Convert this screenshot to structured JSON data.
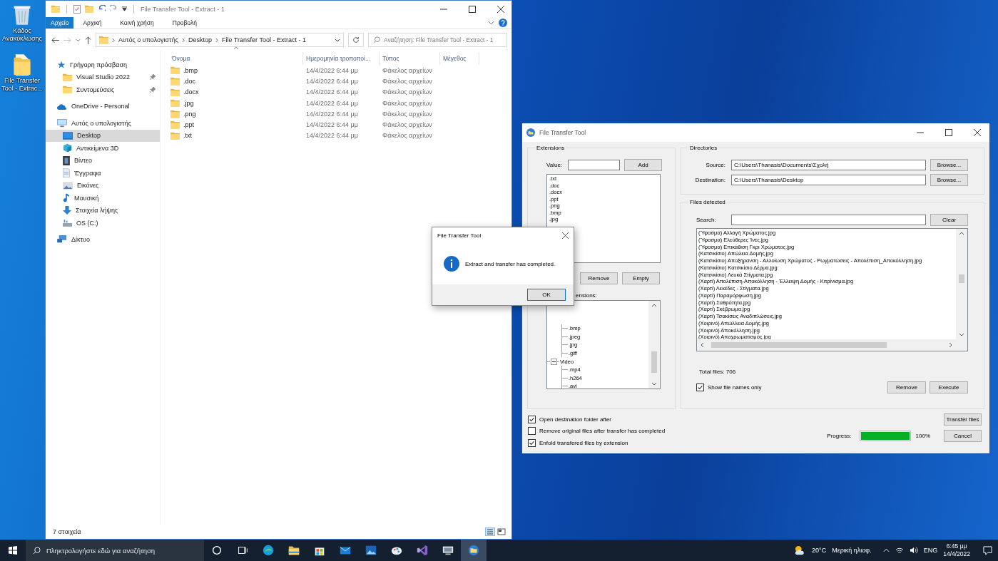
{
  "desktop_icons": [
    {
      "kind": "recycle-bin",
      "label": "Κάδος Ανακύκλωσης"
    },
    {
      "kind": "folder",
      "label": "File Transfer Tool - Extrac..."
    }
  ],
  "explorer": {
    "title": "File Transfer Tool - Extract - 1",
    "ribbon_tabs": [
      {
        "label": "Αρχείο",
        "selected": true
      },
      {
        "label": "Αρχική",
        "selected": false
      },
      {
        "label": "Κοινή χρήση",
        "selected": false
      },
      {
        "label": "Προβολή",
        "selected": false
      }
    ],
    "breadcrumb": [
      "Αυτός ο υπολογιστής",
      "Desktop",
      "File Transfer Tool - Extract - 1"
    ],
    "search": {
      "placeholder": "Αναζήτηση: File Transfer Tool - Extract - 1"
    },
    "nav": [
      {
        "kind": "star",
        "label": "Γρήγορη πρόσβαση",
        "selected": false,
        "children": [
          {
            "kind": "folder",
            "label": "Visual Studio 2022",
            "selected": false,
            "pinned": true
          },
          {
            "kind": "folder",
            "label": "Συντομεύσεις",
            "selected": false,
            "pinned": true
          }
        ]
      },
      {
        "kind": "cloud",
        "label": "OneDrive - Personal",
        "selected": false
      },
      {
        "kind": "pc",
        "label": "Αυτός ο υπολογιστής",
        "selected": false,
        "children": [
          {
            "kind": "desktop",
            "label": "Desktop",
            "selected": true
          },
          {
            "kind": "cube",
            "label": "Αντικείμενα 3D",
            "selected": false
          },
          {
            "kind": "video",
            "label": "Βίντεο",
            "selected": false
          },
          {
            "kind": "document",
            "label": "Έγγραφα",
            "selected": false
          },
          {
            "kind": "pictures",
            "label": "Εικόνες",
            "selected": false
          },
          {
            "kind": "music",
            "label": "Μουσική",
            "selected": false
          },
          {
            "kind": "download",
            "label": "Στοιχεία λήψης",
            "selected": false
          },
          {
            "kind": "drive",
            "label": "OS (C:)",
            "selected": false
          }
        ]
      },
      {
        "kind": "network",
        "label": "Δίκτυο",
        "selected": false
      }
    ],
    "columns": [
      "Όνομα",
      "Ημερομηνία τροποποί...",
      "Τύπος",
      "Μέγεθος"
    ],
    "rows": [
      {
        "name": ".bmp",
        "modified": "14/4/2022 6:44 μμ",
        "type": "Φάκελος αρχείων"
      },
      {
        "name": ".doc",
        "modified": "14/4/2022 6:44 μμ",
        "type": "Φάκελος αρχείων"
      },
      {
        "name": ".docx",
        "modified": "14/4/2022 6:44 μμ",
        "type": "Φάκελος αρχείων"
      },
      {
        "name": ".jpg",
        "modified": "14/4/2022 6:44 μμ",
        "type": "Φάκελος αρχείων"
      },
      {
        "name": ".png",
        "modified": "14/4/2022 6:44 μμ",
        "type": "Φάκελος αρχείων"
      },
      {
        "name": ".ppt",
        "modified": "14/4/2022 6:44 μμ",
        "type": "Φάκελος αρχείων"
      },
      {
        "name": ".txt",
        "modified": "14/4/2022 6:44 μμ",
        "type": "Φάκελος αρχείων"
      }
    ],
    "status": "7 στοιχεία"
  },
  "transfer_tool": {
    "title": "File Transfer Tool",
    "extensions": {
      "title": "Extensions",
      "value_label": "Value:",
      "add_button": "Add",
      "items": [
        ".txt",
        ".doc",
        ".docx",
        ".ppt",
        ".png",
        ".bmp",
        ".jpg"
      ],
      "buttons": [
        "Remove",
        "Empty"
      ],
      "tree_label": "ensions:",
      "tree": [
        {
          "children": [
            {
              "label": ".bmp"
            },
            {
              "label": ".jpeg"
            },
            {
              "label": ".jpg"
            },
            {
              "label": ".giff"
            }
          ]
        },
        {
          "label": "Video",
          "expanded": true,
          "children": [
            {
              "label": ".mp4"
            },
            {
              "label": ".h264"
            },
            {
              "label": ".avi"
            }
          ]
        }
      ]
    },
    "directories": {
      "title": "Directories",
      "rows": [
        {
          "label": "Source:",
          "value": "C:\\Users\\Thanasis\\Documents\\Σχολή",
          "button": "Browse..."
        },
        {
          "label": "Destination:",
          "value": "C:\\Users\\Thanasis\\Desktop",
          "button": "Browse..."
        }
      ]
    },
    "files": {
      "title": "Files detected",
      "search_label": "Search:",
      "clear_button": "Clear",
      "items": [
        "(Ύφασμα) Αλλαγή Χρώματος.jpg",
        "(Ύφασμα) Ελεύθερες Ίνες.jpg",
        "(Ύφασμα) Επικάθιση Γκρι Χρώματος.jpg",
        "(Κατσικίσιο) Απώλεια Δομής.jpg",
        "(Κατσικίσιο) Αποξήρανση - Αλλοίωση Χρώματος - Ρωγματώσεις - Απολέπιση_Αποκόλληση.jpg",
        "(Κατσικίσιο) Κατσικίσιο Δέρμα.jpg",
        "(Κατσικίσιο) Λευκά Στίγματα.jpg",
        "(Χαρτί) Απολέπιση-Αποκόλληση - Έλλειψη Δομής - Κιτρίνισμα.jpg",
        "(Χαρτί) Λεκέδες - Στίγματα.jpg",
        "(Χαρτί) Παραμόρφωση.jpg",
        "(Χαρτί) Σαθρότητα.jpg",
        "(Χαρτί) Σκέβρωμα.jpg",
        "(Χαρτί) Τσακίσεις Αναδιπλώσεις.jpg",
        "(Χοιρινό) Απώλλεια Δομής.jpg",
        "(Χοιρινό) Αποκόλληση.jpg",
        "(Χοιρινό) Αποχρωματισμός.jpg"
      ],
      "total": "Total files: 706",
      "show_names_only": {
        "label": "Show file names only",
        "checked": true
      },
      "buttons": [
        "Remove",
        "Execute"
      ]
    },
    "options": [
      {
        "label": "Open destination folder after",
        "checked": true
      },
      {
        "label": "Remove original files after transfer has completed",
        "checked": false
      },
      {
        "label": "Enfold transfered files by extension",
        "checked": true
      }
    ],
    "transfer_button": "Transfer files",
    "progress": {
      "label": "Progress:",
      "level": 1,
      "reading": "100%"
    },
    "cancel_button": "Cancel"
  },
  "dialog": {
    "title": "File Transfer Tool",
    "message": "Extract and transfer has completed.",
    "button": "OK"
  },
  "taskbar": {
    "search_placeholder": "Πληκτρολογήστε εδώ για αναζήτηση",
    "apps": [
      {
        "kind": "cortana",
        "active": false
      },
      {
        "kind": "task-view",
        "active": false
      },
      {
        "kind": "edge",
        "active": false
      },
      {
        "kind": "explorer",
        "active": false
      },
      {
        "kind": "store",
        "active": false
      },
      {
        "kind": "mail",
        "active": false
      },
      {
        "kind": "photos",
        "active": false
      },
      {
        "kind": "paint",
        "active": false
      },
      {
        "kind": "visual-studio",
        "active": false
      },
      {
        "kind": "remote",
        "active": false
      },
      {
        "kind": "transfer-tool",
        "active": true
      }
    ],
    "weather": {
      "temperature": "20°C",
      "condition": "Μερική ηλιοφ."
    },
    "language": "ENG",
    "time": "6:45 μμ",
    "date": "14/4/2022"
  }
}
